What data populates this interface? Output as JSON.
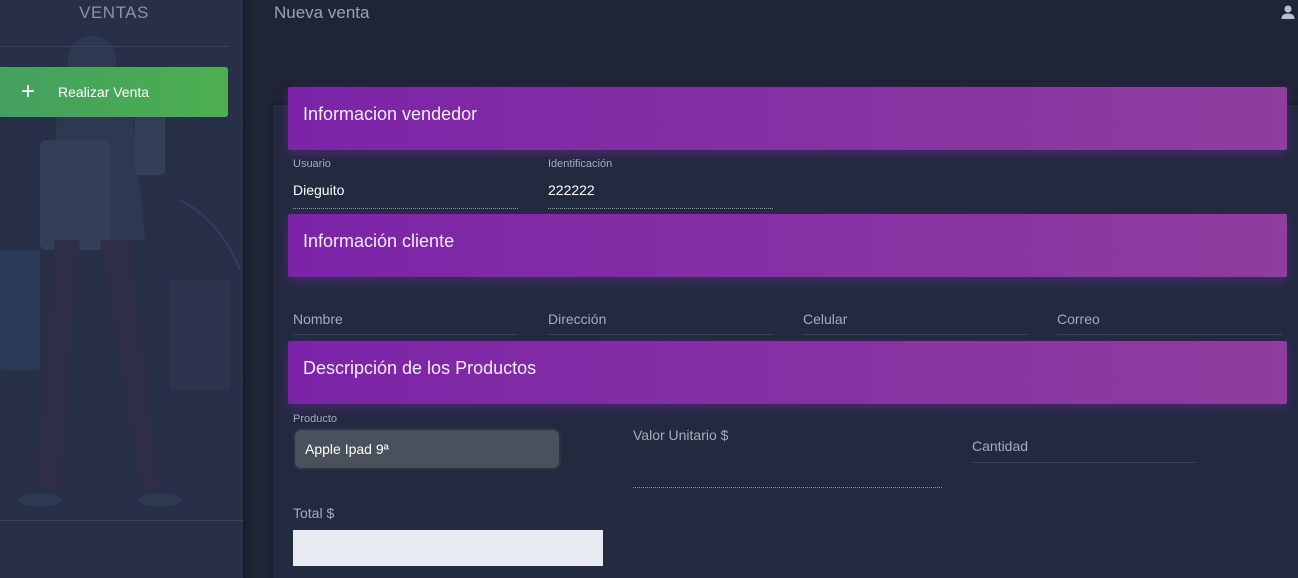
{
  "sidebar": {
    "title": "VENTAS",
    "sell_button_label": "Realizar Venta",
    "sell_button_icon": "plus-icon",
    "accent_color": "#4caf50"
  },
  "header": {
    "title": "Nueva venta",
    "user_icon": "user-icon"
  },
  "seller_section": {
    "title": "Informacion vendedor",
    "user_label": "Usuario",
    "user_value": "Dieguito",
    "id_label": "Identificación",
    "id_value": "222222"
  },
  "client_section": {
    "title": "Información cliente",
    "name_placeholder": "Nombre",
    "address_placeholder": "Dirección",
    "phone_placeholder": "Celular",
    "email_placeholder": "Correo"
  },
  "products_section": {
    "title": "Descripción de los Productos",
    "product_label": "Producto",
    "product_value": "Apple Ipad 9ª",
    "unit_price_label": "Valor Unitario $",
    "quantity_placeholder": "Cantidad",
    "total_label": "Total $",
    "total_value": ""
  },
  "colors": {
    "section_header": "#7b24a8",
    "background": "#1f2437",
    "sidebar": "#283047"
  }
}
